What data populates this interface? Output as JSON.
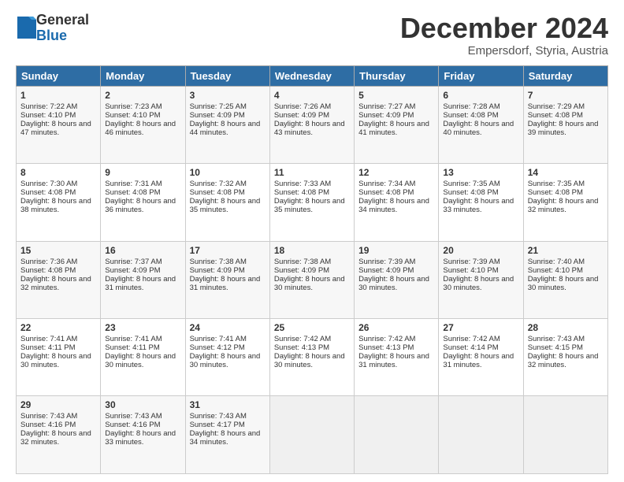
{
  "header": {
    "logo_general": "General",
    "logo_blue": "Blue",
    "month_title": "December 2024",
    "location": "Empersdorf, Styria, Austria"
  },
  "weekdays": [
    "Sunday",
    "Monday",
    "Tuesday",
    "Wednesday",
    "Thursday",
    "Friday",
    "Saturday"
  ],
  "weeks": [
    [
      {
        "day": "1",
        "sunrise": "Sunrise: 7:22 AM",
        "sunset": "Sunset: 4:10 PM",
        "daylight": "Daylight: 8 hours and 47 minutes."
      },
      {
        "day": "2",
        "sunrise": "Sunrise: 7:23 AM",
        "sunset": "Sunset: 4:10 PM",
        "daylight": "Daylight: 8 hours and 46 minutes."
      },
      {
        "day": "3",
        "sunrise": "Sunrise: 7:25 AM",
        "sunset": "Sunset: 4:09 PM",
        "daylight": "Daylight: 8 hours and 44 minutes."
      },
      {
        "day": "4",
        "sunrise": "Sunrise: 7:26 AM",
        "sunset": "Sunset: 4:09 PM",
        "daylight": "Daylight: 8 hours and 43 minutes."
      },
      {
        "day": "5",
        "sunrise": "Sunrise: 7:27 AM",
        "sunset": "Sunset: 4:09 PM",
        "daylight": "Daylight: 8 hours and 41 minutes."
      },
      {
        "day": "6",
        "sunrise": "Sunrise: 7:28 AM",
        "sunset": "Sunset: 4:08 PM",
        "daylight": "Daylight: 8 hours and 40 minutes."
      },
      {
        "day": "7",
        "sunrise": "Sunrise: 7:29 AM",
        "sunset": "Sunset: 4:08 PM",
        "daylight": "Daylight: 8 hours and 39 minutes."
      }
    ],
    [
      {
        "day": "8",
        "sunrise": "Sunrise: 7:30 AM",
        "sunset": "Sunset: 4:08 PM",
        "daylight": "Daylight: 8 hours and 38 minutes."
      },
      {
        "day": "9",
        "sunrise": "Sunrise: 7:31 AM",
        "sunset": "Sunset: 4:08 PM",
        "daylight": "Daylight: 8 hours and 36 minutes."
      },
      {
        "day": "10",
        "sunrise": "Sunrise: 7:32 AM",
        "sunset": "Sunset: 4:08 PM",
        "daylight": "Daylight: 8 hours and 35 minutes."
      },
      {
        "day": "11",
        "sunrise": "Sunrise: 7:33 AM",
        "sunset": "Sunset: 4:08 PM",
        "daylight": "Daylight: 8 hours and 35 minutes."
      },
      {
        "day": "12",
        "sunrise": "Sunrise: 7:34 AM",
        "sunset": "Sunset: 4:08 PM",
        "daylight": "Daylight: 8 hours and 34 minutes."
      },
      {
        "day": "13",
        "sunrise": "Sunrise: 7:35 AM",
        "sunset": "Sunset: 4:08 PM",
        "daylight": "Daylight: 8 hours and 33 minutes."
      },
      {
        "day": "14",
        "sunrise": "Sunrise: 7:35 AM",
        "sunset": "Sunset: 4:08 PM",
        "daylight": "Daylight: 8 hours and 32 minutes."
      }
    ],
    [
      {
        "day": "15",
        "sunrise": "Sunrise: 7:36 AM",
        "sunset": "Sunset: 4:08 PM",
        "daylight": "Daylight: 8 hours and 32 minutes."
      },
      {
        "day": "16",
        "sunrise": "Sunrise: 7:37 AM",
        "sunset": "Sunset: 4:09 PM",
        "daylight": "Daylight: 8 hours and 31 minutes."
      },
      {
        "day": "17",
        "sunrise": "Sunrise: 7:38 AM",
        "sunset": "Sunset: 4:09 PM",
        "daylight": "Daylight: 8 hours and 31 minutes."
      },
      {
        "day": "18",
        "sunrise": "Sunrise: 7:38 AM",
        "sunset": "Sunset: 4:09 PM",
        "daylight": "Daylight: 8 hours and 30 minutes."
      },
      {
        "day": "19",
        "sunrise": "Sunrise: 7:39 AM",
        "sunset": "Sunset: 4:09 PM",
        "daylight": "Daylight: 8 hours and 30 minutes."
      },
      {
        "day": "20",
        "sunrise": "Sunrise: 7:39 AM",
        "sunset": "Sunset: 4:10 PM",
        "daylight": "Daylight: 8 hours and 30 minutes."
      },
      {
        "day": "21",
        "sunrise": "Sunrise: 7:40 AM",
        "sunset": "Sunset: 4:10 PM",
        "daylight": "Daylight: 8 hours and 30 minutes."
      }
    ],
    [
      {
        "day": "22",
        "sunrise": "Sunrise: 7:41 AM",
        "sunset": "Sunset: 4:11 PM",
        "daylight": "Daylight: 8 hours and 30 minutes."
      },
      {
        "day": "23",
        "sunrise": "Sunrise: 7:41 AM",
        "sunset": "Sunset: 4:11 PM",
        "daylight": "Daylight: 8 hours and 30 minutes."
      },
      {
        "day": "24",
        "sunrise": "Sunrise: 7:41 AM",
        "sunset": "Sunset: 4:12 PM",
        "daylight": "Daylight: 8 hours and 30 minutes."
      },
      {
        "day": "25",
        "sunrise": "Sunrise: 7:42 AM",
        "sunset": "Sunset: 4:13 PM",
        "daylight": "Daylight: 8 hours and 30 minutes."
      },
      {
        "day": "26",
        "sunrise": "Sunrise: 7:42 AM",
        "sunset": "Sunset: 4:13 PM",
        "daylight": "Daylight: 8 hours and 31 minutes."
      },
      {
        "day": "27",
        "sunrise": "Sunrise: 7:42 AM",
        "sunset": "Sunset: 4:14 PM",
        "daylight": "Daylight: 8 hours and 31 minutes."
      },
      {
        "day": "28",
        "sunrise": "Sunrise: 7:43 AM",
        "sunset": "Sunset: 4:15 PM",
        "daylight": "Daylight: 8 hours and 32 minutes."
      }
    ],
    [
      {
        "day": "29",
        "sunrise": "Sunrise: 7:43 AM",
        "sunset": "Sunset: 4:16 PM",
        "daylight": "Daylight: 8 hours and 32 minutes."
      },
      {
        "day": "30",
        "sunrise": "Sunrise: 7:43 AM",
        "sunset": "Sunset: 4:16 PM",
        "daylight": "Daylight: 8 hours and 33 minutes."
      },
      {
        "day": "31",
        "sunrise": "Sunrise: 7:43 AM",
        "sunset": "Sunset: 4:17 PM",
        "daylight": "Daylight: 8 hours and 34 minutes."
      },
      null,
      null,
      null,
      null
    ]
  ]
}
